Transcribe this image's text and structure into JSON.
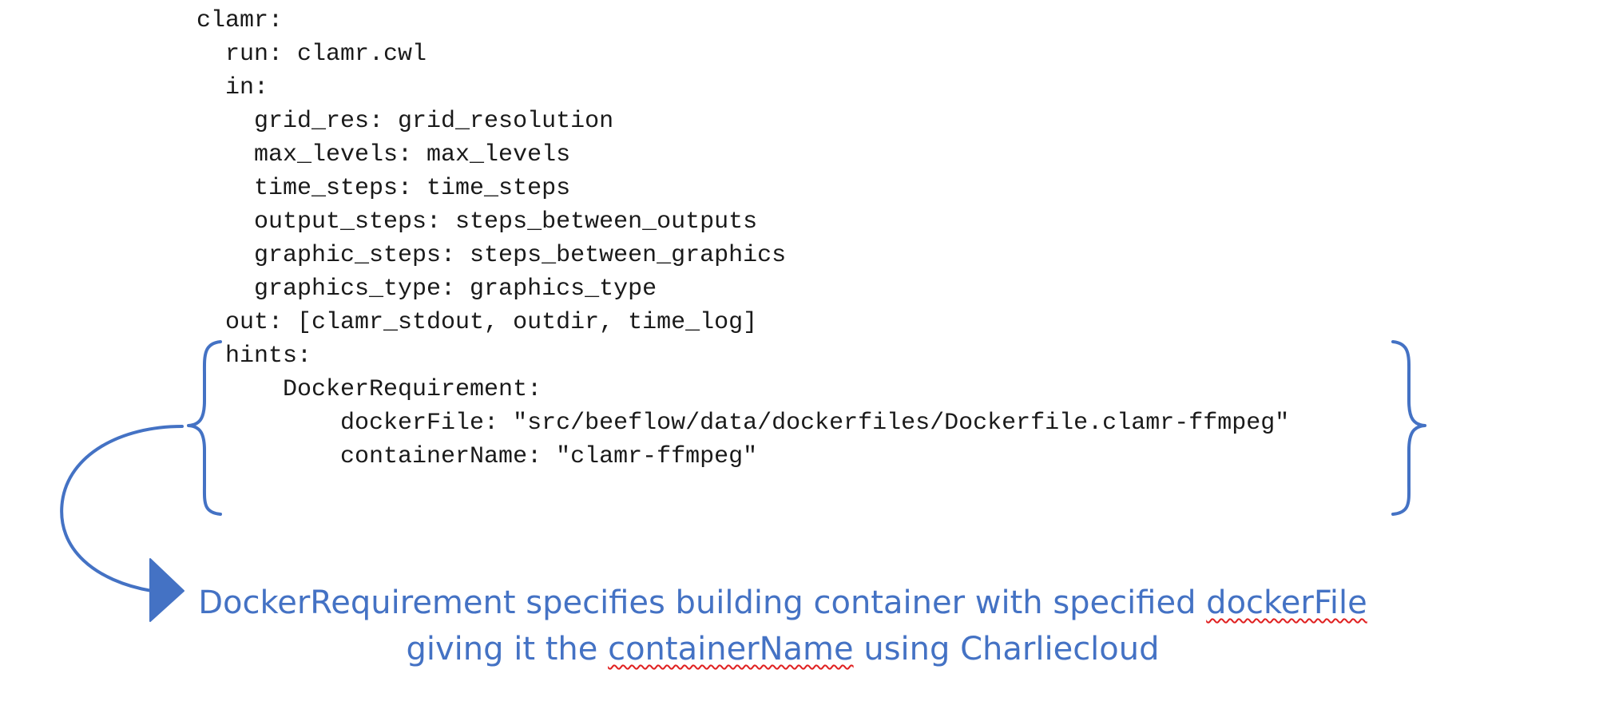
{
  "code": {
    "lines": [
      "clamr:",
      "  run: clamr.cwl",
      "  in:",
      "    grid_res: grid_resolution",
      "    max_levels: max_levels",
      "    time_steps: time_steps",
      "    output_steps: steps_between_outputs",
      "    graphic_steps: steps_between_graphics",
      "    graphics_type: graphics_type",
      "  out: [clamr_stdout, outdir, time_log]",
      "  hints:",
      "      DockerRequirement:",
      "          dockerFile: \"src/beeflow/data/dockerfiles/Dockerfile.clamr-ffmpeg\"",
      "          containerName: \"clamr-ffmpeg\""
    ]
  },
  "annotation": {
    "line1": {
      "part1": "DockerRequirement specifies building container with specified ",
      "part2": "dockerFile"
    },
    "line2": {
      "part1": "giving it the ",
      "part2": "containerName",
      "part3": " using Charliecloud"
    },
    "color": "#4472c4",
    "spellcheck_color": "#e02020"
  }
}
